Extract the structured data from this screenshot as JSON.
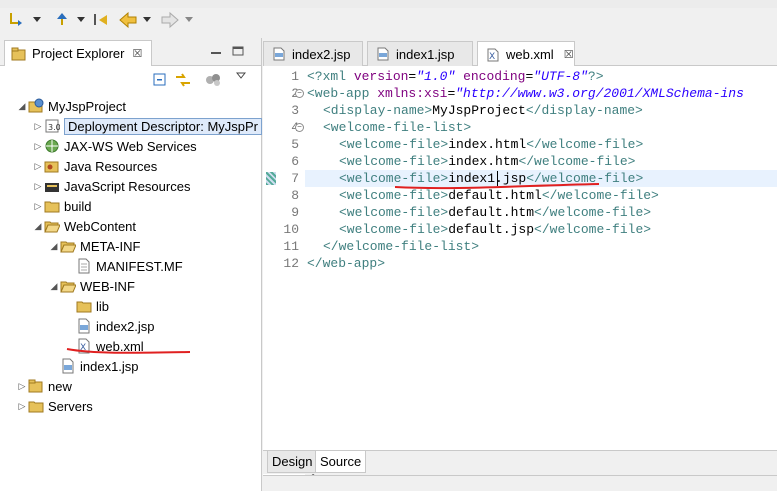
{
  "explorer": {
    "tab_label": "Project Explorer",
    "tab_close": "☒",
    "items": [
      {
        "label": "MyJspProject"
      },
      {
        "label": "Deployment Descriptor: MyJspPr"
      },
      {
        "label": "JAX-WS Web Services"
      },
      {
        "label": "Java Resources"
      },
      {
        "label": "JavaScript Resources"
      },
      {
        "label": "build"
      },
      {
        "label": "WebContent"
      },
      {
        "label": "META-INF"
      },
      {
        "label": "MANIFEST.MF"
      },
      {
        "label": "WEB-INF"
      },
      {
        "label": "lib"
      },
      {
        "label": "index2.jsp"
      },
      {
        "label": "web.xml"
      },
      {
        "label": "index1.jsp"
      },
      {
        "label": "new"
      },
      {
        "label": "Servers"
      }
    ]
  },
  "editor": {
    "tabs": [
      {
        "label": "index2.jsp"
      },
      {
        "label": "index1.jsp"
      },
      {
        "label": "web.xml"
      }
    ],
    "tab_close": "☒",
    "lines": [
      "1",
      "2",
      "3",
      "4",
      "5",
      "6",
      "7",
      "8",
      "9",
      "10",
      "11",
      "12"
    ],
    "code": {
      "l1": {
        "a": "<?xml ",
        "b": "version",
        "c": "=",
        "d": "\"1.0\"",
        "e": " ",
        "f": "encoding",
        "g": "=",
        "h": "\"UTF-8\"",
        "i": "?>"
      },
      "l2": {
        "a": "<web-app ",
        "b": "xmlns:xsi",
        "c": "=",
        "d": "\"http://www.w3.org/2001/XMLSchema-ins"
      },
      "l3": {
        "a": "<display-name>",
        "b": "MyJspProject",
        "c": "</display-name>"
      },
      "l4": {
        "a": "<welcome-file-list>"
      },
      "l5": {
        "a": "<welcome-file>",
        "b": "index.html",
        "c": "</welcome-file>"
      },
      "l6": {
        "a": "<welcome-file>",
        "b": "index.htm",
        "c": "</welcome-file>"
      },
      "l7": {
        "a": "<welcome-file>",
        "b": "index1.jsp",
        "c": "</welcome-file>"
      },
      "l8": {
        "a": "<welcome-file>",
        "b": "default.html",
        "c": "</welcome-file>"
      },
      "l9": {
        "a": "<welcome-file>",
        "b": "default.htm",
        "c": "</welcome-file>"
      },
      "l10": {
        "a": "<welcome-file>",
        "b": "default.jsp",
        "c": "</welcome-file>"
      },
      "l11": {
        "a": "</welcome-file-list>"
      },
      "l12": {
        "a": "</web-app>"
      }
    },
    "bottom_tabs": [
      {
        "label": "Design"
      },
      {
        "label": "Source"
      }
    ]
  },
  "colors": {
    "tag": "#3f7f7f",
    "attr": "#7f007f",
    "value": "#2a00ff",
    "annotation": "#e02020"
  }
}
